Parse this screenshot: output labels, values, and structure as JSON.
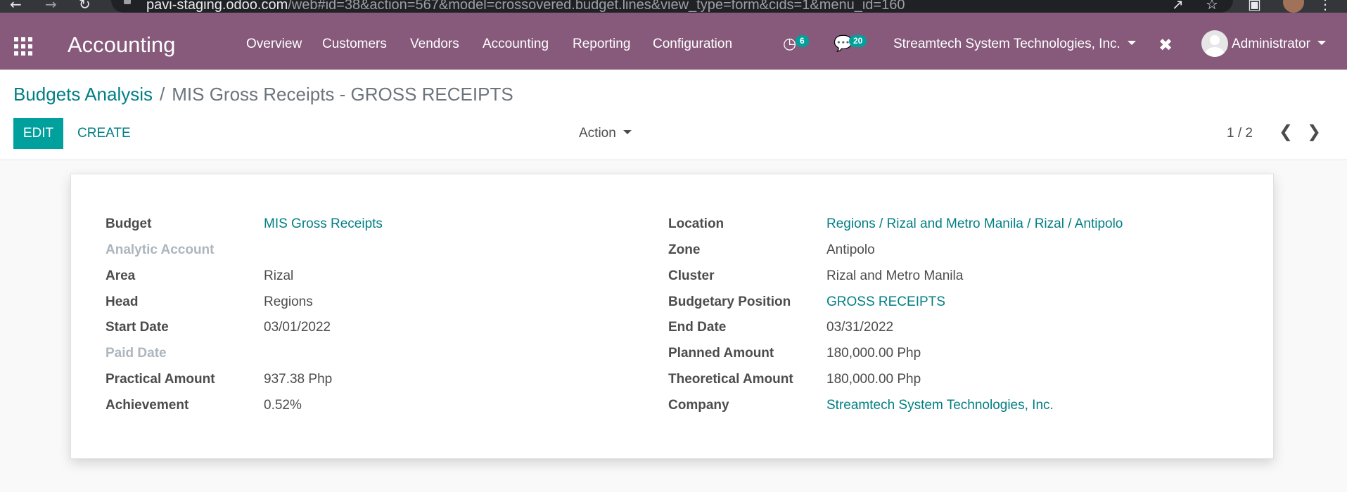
{
  "browser": {
    "url_host": "pavi-staging.odoo.com",
    "url_path": "/web#id=38&action=567&model=crossovered.budget.lines&view_type=form&cids=1&menu_id=160"
  },
  "navbar": {
    "app_title": "Accounting",
    "menu": [
      "Overview",
      "Customers",
      "Vendors",
      "Accounting",
      "Reporting",
      "Configuration"
    ],
    "activity_count": "6",
    "messages_count": "20",
    "company": "Streamtech System Technologies, Inc.",
    "user": "Administrator"
  },
  "control_panel": {
    "breadcrumb_parent": "Budgets Analysis",
    "breadcrumb_separator": "/",
    "breadcrumb_current": "MIS Gross Receipts - GROSS RECEIPTS",
    "edit_label": "EDIT",
    "create_label": "CREATE",
    "action_label": "Action",
    "pager": "1 / 2"
  },
  "form": {
    "left": [
      {
        "label": "Budget",
        "value": "MIS Gross Receipts",
        "link": true,
        "muted": false
      },
      {
        "label": "Analytic Account",
        "value": "",
        "link": false,
        "muted": true
      },
      {
        "label": "Area",
        "value": "Rizal",
        "link": false,
        "muted": false
      },
      {
        "label": "Head",
        "value": "Regions",
        "link": false,
        "muted": false
      },
      {
        "label": "Start Date",
        "value": "03/01/2022",
        "link": false,
        "muted": false
      },
      {
        "label": "Paid Date",
        "value": "",
        "link": false,
        "muted": true
      },
      {
        "label": "Practical Amount",
        "value": "937.38 Php",
        "link": false,
        "muted": false
      },
      {
        "label": "Achievement",
        "value": "0.52%",
        "link": false,
        "muted": false
      }
    ],
    "right": [
      {
        "label": "Location",
        "value": "Regions / Rizal and Metro Manila / Rizal / Antipolo",
        "link": true
      },
      {
        "label": "Zone",
        "value": "Antipolo",
        "link": false
      },
      {
        "label": "Cluster",
        "value": "Rizal and Metro Manila",
        "link": false
      },
      {
        "label": "Budgetary Position",
        "value": "GROSS RECEIPTS",
        "link": true
      },
      {
        "label": "End Date",
        "value": "03/31/2022",
        "link": false
      },
      {
        "label": "Planned Amount",
        "value": "180,000.00 Php",
        "link": false
      },
      {
        "label": "Theoretical Amount",
        "value": "180,000.00 Php",
        "link": false
      },
      {
        "label": "Company",
        "value": "Streamtech System Technologies, Inc.",
        "link": true
      }
    ]
  },
  "colors": {
    "navbar": "#875a7b",
    "primary": "#00a09d",
    "link": "#017e84"
  }
}
